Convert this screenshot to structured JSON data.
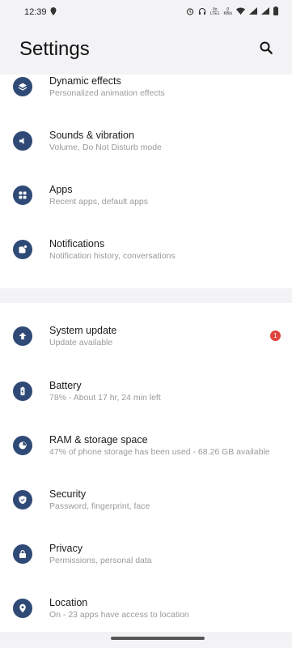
{
  "status_bar": {
    "time": "12:39",
    "net_label_top": "Vo",
    "net_label_bottom": "LTE1",
    "speed_value": "0",
    "speed_unit": "KB/s"
  },
  "header": {
    "title": "Settings"
  },
  "settings_groups": [
    {
      "items": [
        {
          "title": "Dynamic effects",
          "subtitle": "Personalized animation effects"
        },
        {
          "title": "Sounds & vibration",
          "subtitle": "Volume, Do Not Disturb mode"
        },
        {
          "title": "Apps",
          "subtitle": "Recent apps, default apps"
        },
        {
          "title": "Notifications",
          "subtitle": "Notification history, conversations"
        }
      ]
    },
    {
      "items": [
        {
          "title": "System update",
          "subtitle": "Update available",
          "badge": "1"
        },
        {
          "title": "Battery",
          "subtitle": "78% - About 17 hr, 24 min left"
        },
        {
          "title": "RAM & storage space",
          "subtitle": "47% of phone storage has been used - 68.26 GB available"
        },
        {
          "title": "Security",
          "subtitle": "Password, fingerprint, face"
        },
        {
          "title": "Privacy",
          "subtitle": "Permissions, personal data"
        },
        {
          "title": "Location",
          "subtitle": "On - 23 apps have access to location"
        }
      ]
    }
  ],
  "colors": {
    "icon_bg": "#2f4a76",
    "badge": "#e0443e",
    "background": "#f3f3f6"
  }
}
